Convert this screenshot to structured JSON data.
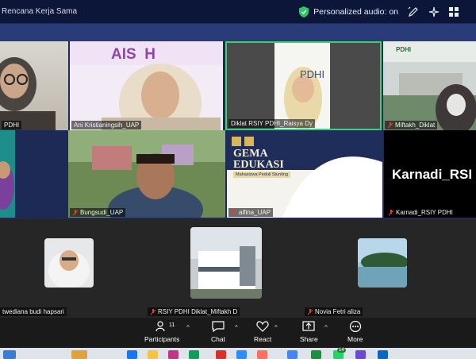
{
  "window": {
    "title": "Rencana Kerja Sama"
  },
  "topbar": {
    "audio_label": "Personalized audio: on"
  },
  "participants": [
    {
      "name": "PDHI"
    },
    {
      "name": "Ani Kristianingsih_UAP"
    },
    {
      "name": "Diklat RSIY PDHI_Raisya Dy"
    },
    {
      "name": "Miftakh_Diklat"
    },
    {
      "name": ""
    },
    {
      "name": "Bungsudi_UAP"
    },
    {
      "name": "alfina_UAP"
    },
    {
      "name": "Karnadi_RSIY PDHI",
      "big_label": "Karnadi_RSI"
    },
    {
      "name": "twediana budi hapsari"
    },
    {
      "name": "RSIY PDHI Diklat_Miftakh D"
    },
    {
      "name": "Novia Fetri aliza"
    }
  ],
  "tile_texts": {
    "banner_text": "AIS  H",
    "pdhi_badge": "PDHI",
    "gema_title": "GEMA",
    "gema_sub": "EDUKASI",
    "gema_tag": "Mahasiswa Peduli Stunting"
  },
  "toolbar": {
    "participants": {
      "label": "Participants",
      "count": "11"
    },
    "chat": {
      "label": "Chat"
    },
    "react": {
      "label": "React"
    },
    "share": {
      "label": "Share"
    },
    "more": {
      "label": "More"
    }
  },
  "taskbar": {
    "badge_count": "14"
  },
  "colors": {
    "speaker_border": "#3cd175",
    "titlebar": "#0b1638",
    "toolbar": "#1a1a1a",
    "mute_icon": "#e03b3b"
  }
}
